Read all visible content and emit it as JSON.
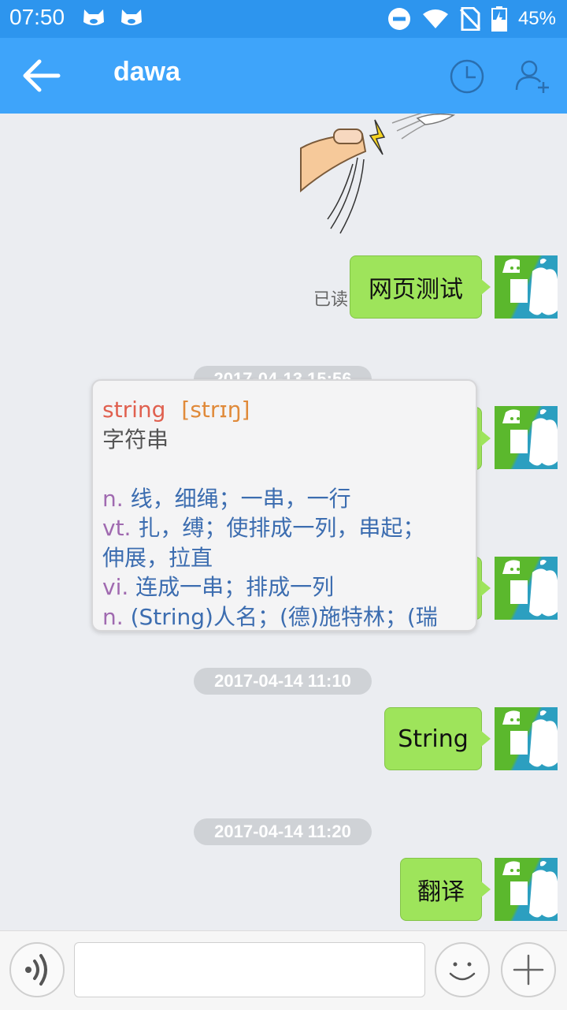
{
  "status_bar": {
    "time": "07:50",
    "battery": "45%"
  },
  "header": {
    "title": "dawa"
  },
  "messages": [
    {
      "type": "sticker"
    },
    {
      "type": "text",
      "text": "网页测试",
      "read_label": "已读"
    },
    {
      "type": "timestamp",
      "text": "2017-04-13 15:56"
    },
    {
      "type": "text",
      "text": ""
    },
    {
      "type": "text",
      "text": ""
    },
    {
      "type": "timestamp",
      "text": "2017-04-14 11:10"
    },
    {
      "type": "text",
      "text": "String"
    },
    {
      "type": "timestamp",
      "text": "2017-04-14 11:20"
    },
    {
      "type": "text",
      "text": "翻译"
    }
  ],
  "dictionary_popup": {
    "word": "string",
    "phonetic": "[strɪŋ]",
    "meaning": "字符串",
    "definitions": [
      {
        "pos": "n.",
        "text": "线，细绳；一串，一行"
      },
      {
        "pos": "vt.",
        "text": "扎，缚；使排成一列，串起；"
      },
      {
        "pos": "",
        "text": "伸展，拉直"
      },
      {
        "pos": "vi.",
        "text": "连成一串；排成一列"
      },
      {
        "pos": "n.",
        "text": "(String)人名；(德)施特林；(瑞"
      }
    ]
  },
  "input": {
    "value": ""
  },
  "colors": {
    "status_bar": "#2d95ee",
    "title_bar": "#3ea4fa",
    "bubble": "#9ee45b",
    "background": "#ebedf1"
  }
}
